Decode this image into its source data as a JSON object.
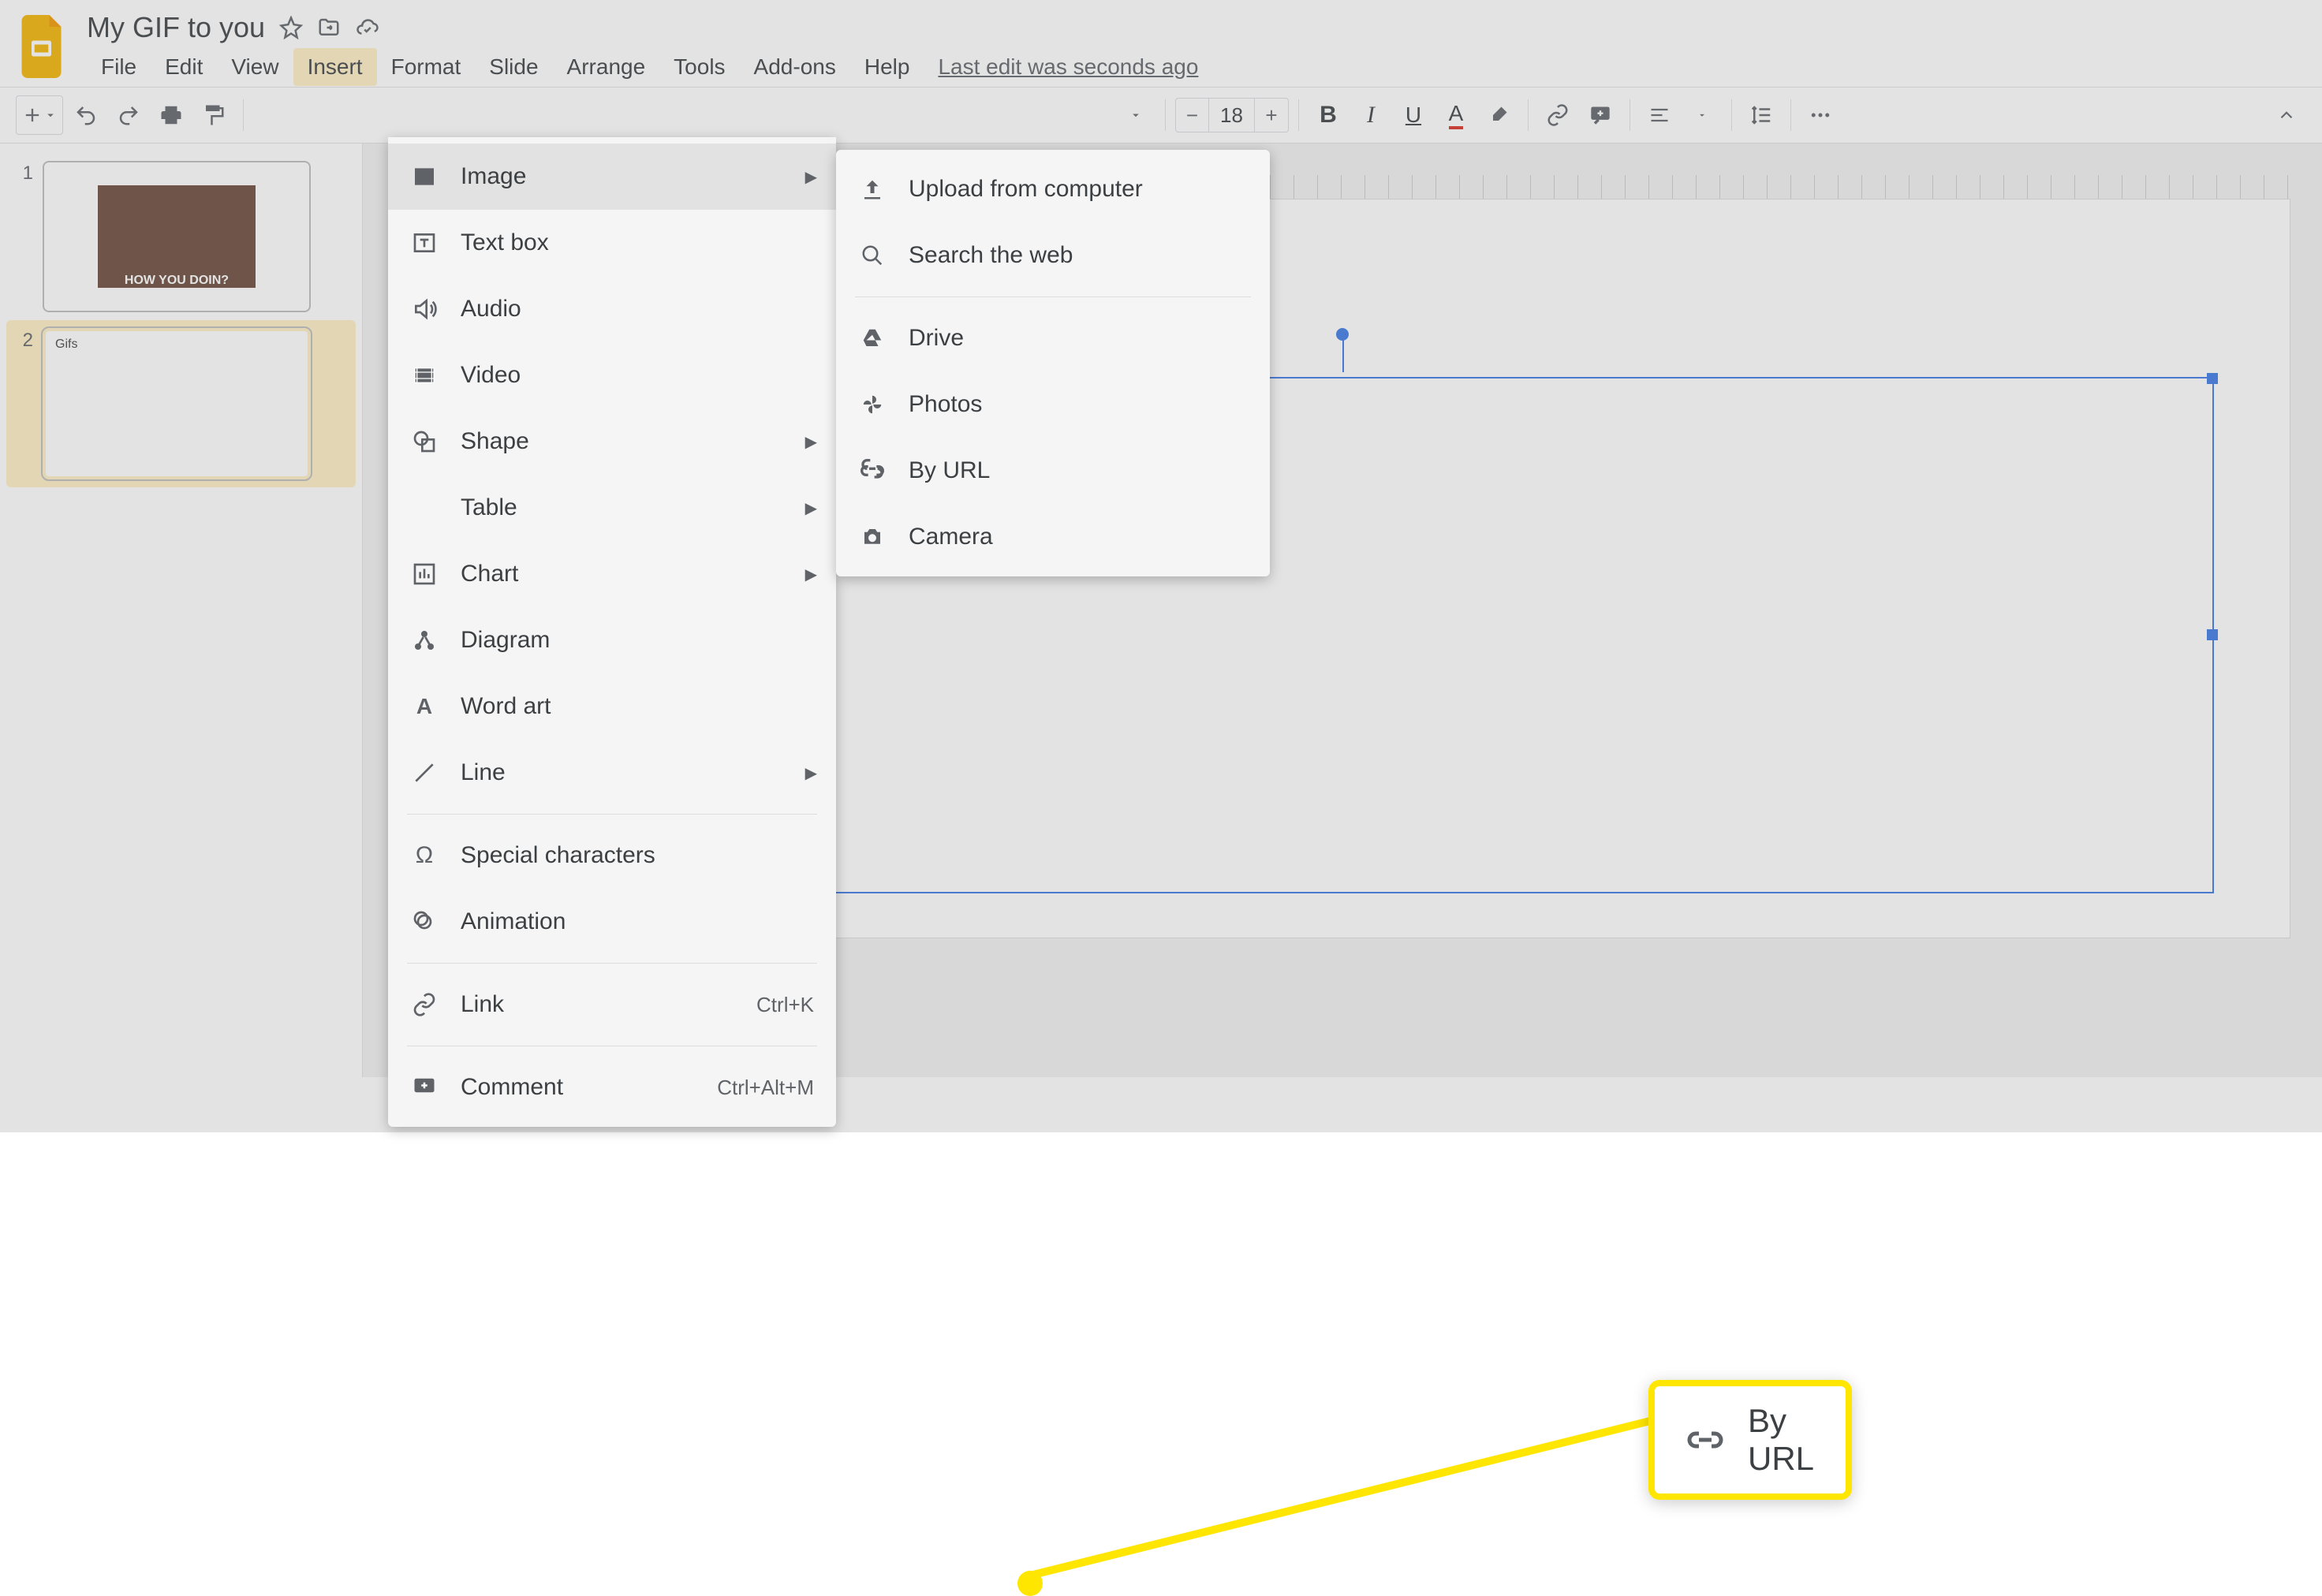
{
  "header": {
    "title": "My GIF to you",
    "last_edit": "Last edit was seconds ago"
  },
  "menus": {
    "file": "File",
    "edit": "Edit",
    "view": "View",
    "insert": "Insert",
    "format": "Format",
    "slide": "Slide",
    "arrange": "Arrange",
    "tools": "Tools",
    "addons": "Add-ons",
    "help": "Help"
  },
  "toolbar": {
    "font_size": "18"
  },
  "filmstrip": {
    "slides": [
      {
        "num": "1",
        "caption": "HOW YOU DOIN?"
      },
      {
        "num": "2",
        "caption": "Gifs"
      }
    ]
  },
  "insert_menu": {
    "image": "Image",
    "textbox": "Text box",
    "audio": "Audio",
    "video": "Video",
    "shape": "Shape",
    "table": "Table",
    "chart": "Chart",
    "diagram": "Diagram",
    "wordart": "Word art",
    "line": "Line",
    "special": "Special characters",
    "animation": "Animation",
    "link": "Link",
    "link_sc": "Ctrl+K",
    "comment": "Comment",
    "comment_sc": "Ctrl+Alt+M"
  },
  "image_menu": {
    "upload": "Upload from computer",
    "search": "Search the web",
    "drive": "Drive",
    "photos": "Photos",
    "byurl": "By URL",
    "camera": "Camera"
  },
  "callout": {
    "label": "By URL"
  }
}
